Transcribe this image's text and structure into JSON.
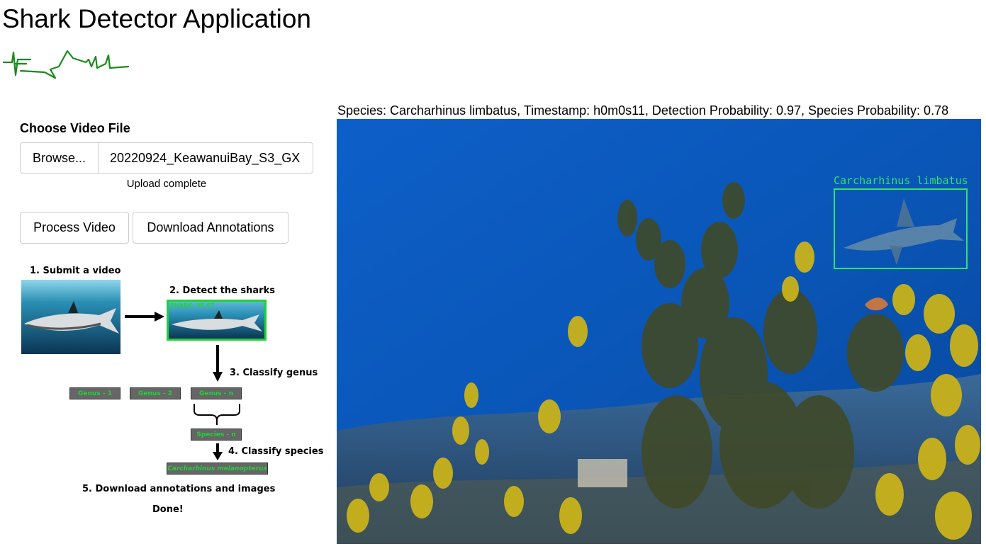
{
  "app": {
    "title": "Shark Detector Application"
  },
  "upload": {
    "heading": "Choose Video File",
    "browse_label": "Browse...",
    "file_name": "20220924_KeawanuiBay_S3_GX",
    "status": "Upload complete"
  },
  "actions": {
    "process_label": "Process Video",
    "download_label": "Download Annotations"
  },
  "workflow": {
    "step1": "1. Submit a video",
    "step2": "2. Detect the sharks",
    "step2_overlay": "SHARK: 99.67",
    "step3": "3. Classify genus",
    "genus_chips": [
      "Genus - 1",
      "Genus - 2",
      "Genus - n"
    ],
    "species_chip": "Species - n",
    "step4": "4. Classify species",
    "result_chip": "Carcharhinus melanopterus",
    "step5": "5. Download annotations and images",
    "done": "Done!"
  },
  "result": {
    "caption": "Species: Carcharhinus limbatus, Timestamp: h0m0s11, Detection Probability: 0.97, Species Probability: 0.78",
    "detection_label": "Carcharhinus limbatus"
  },
  "colors": {
    "detection_green": "#2ee36a",
    "logo_green": "#1a8a1a",
    "chip_text_green": "#22d13a"
  }
}
